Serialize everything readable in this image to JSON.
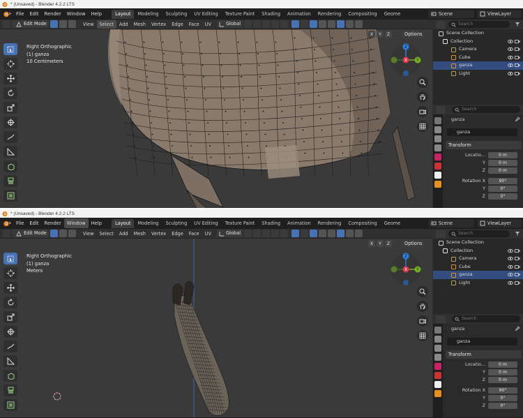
{
  "title": "* (Unsaved) - Blender 4.2.2 LTS",
  "menus": [
    "File",
    "Edit",
    "Render",
    "Window",
    "Help"
  ],
  "workspace_tabs": [
    "Layout",
    "Modeling",
    "Sculpting",
    "UV Editing",
    "Texture Paint",
    "Shading",
    "Animation",
    "Rendering",
    "Compositing",
    "Geome"
  ],
  "active_workspace": "Layout",
  "scene": "Scene",
  "view_layer": "ViewLayer",
  "header": {
    "mode": "Edit Mode",
    "menus": [
      "View",
      "Select",
      "Add",
      "Mesh",
      "Vertex",
      "Edge",
      "Face",
      "UV"
    ],
    "orientation": "Global",
    "options": "Options",
    "axes": [
      "X",
      "Y",
      "Z"
    ]
  },
  "outliner": {
    "search_placeholder": "Search",
    "rows": [
      {
        "label": "Scene Collection"
      },
      {
        "label": "Collection"
      },
      {
        "label": "Camera"
      },
      {
        "label": "Cube"
      },
      {
        "label": "ganza"
      },
      {
        "label": "Light"
      }
    ]
  },
  "properties": {
    "search_placeholder": "Search",
    "object_name": "ganza",
    "data_name": "ganza",
    "transform_label": "Transform",
    "location_label": "Locatio...",
    "rotation_label": "Rotation X",
    "axis_y": "Y",
    "axis_z": "Z",
    "location": [
      "0 m",
      "0 m",
      "0 m"
    ],
    "rotation": [
      "90°",
      "0°",
      "0°"
    ]
  },
  "windows": [
    {
      "view_name": "Right Orthographic",
      "object_info": "(1) ganza",
      "scale": "10 Centimeters",
      "highlight_menu": "",
      "highlight_header": "Select"
    },
    {
      "view_name": "Right Orthographic",
      "object_info": "(1) ganza",
      "scale": "Meters",
      "highlight_menu": "Window",
      "highlight_header": ""
    }
  ],
  "colors": {
    "accent": "#4772b3",
    "viewport_bg": "#3a3a3a",
    "mesh_fill": "#8a7a6c",
    "selected_row": "#334d80"
  },
  "icons": [
    "blender-logo-icon",
    "select-box-icon",
    "cursor-icon",
    "move-icon",
    "rotate-icon",
    "scale-icon",
    "transform-icon",
    "annotate-icon",
    "measure-icon",
    "extrude-icon",
    "inset-icon",
    "bevel-icon",
    "zoom-icon",
    "hand-icon",
    "camera-icon",
    "grid-icon",
    "eye-icon",
    "camera-render-icon",
    "search-icon",
    "pin-icon"
  ]
}
